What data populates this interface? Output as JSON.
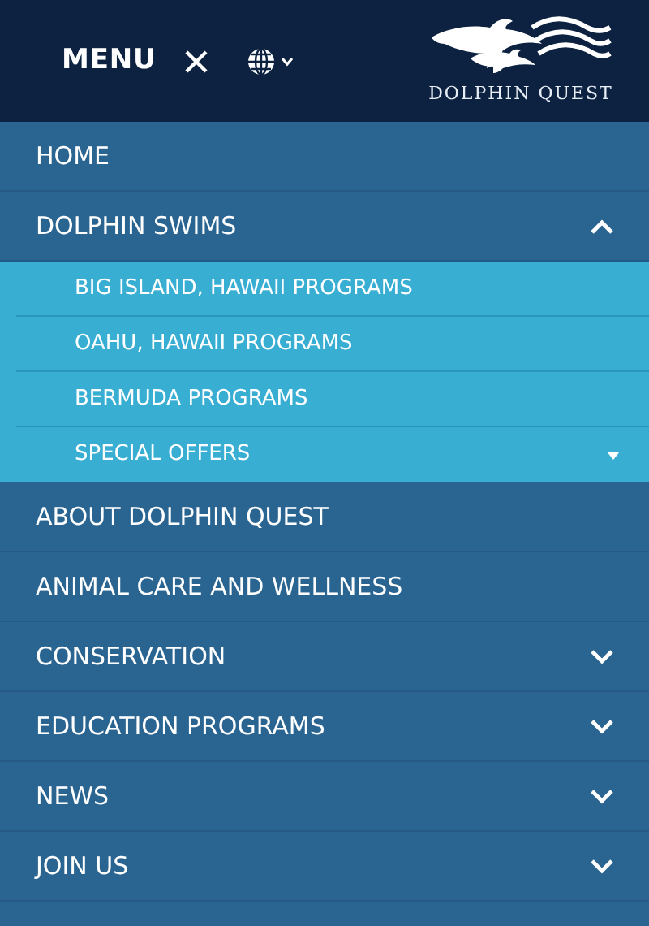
{
  "header": {
    "menu_label": "MENU",
    "logo_text": "DOLPHIN QUEST"
  },
  "menu": [
    {
      "label": "HOME",
      "kind": "link"
    },
    {
      "label": "DOLPHIN SWIMS",
      "kind": "group",
      "expanded": true,
      "children": [
        {
          "label": "BIG ISLAND, HAWAII PROGRAMS",
          "kind": "link"
        },
        {
          "label": "OAHU, HAWAII PROGRAMS",
          "kind": "link"
        },
        {
          "label": "BERMUDA PROGRAMS",
          "kind": "link"
        },
        {
          "label": "SPECIAL OFFERS",
          "kind": "group",
          "expanded": false
        }
      ]
    },
    {
      "label": "ABOUT DOLPHIN QUEST",
      "kind": "link"
    },
    {
      "label": "ANIMAL CARE AND WELLNESS",
      "kind": "link"
    },
    {
      "label": "CONSERVATION",
      "kind": "group",
      "expanded": false
    },
    {
      "label": "EDUCATION PROGRAMS",
      "kind": "group",
      "expanded": false
    },
    {
      "label": "NEWS",
      "kind": "group",
      "expanded": false
    },
    {
      "label": "JOIN US",
      "kind": "group",
      "expanded": false
    }
  ]
}
